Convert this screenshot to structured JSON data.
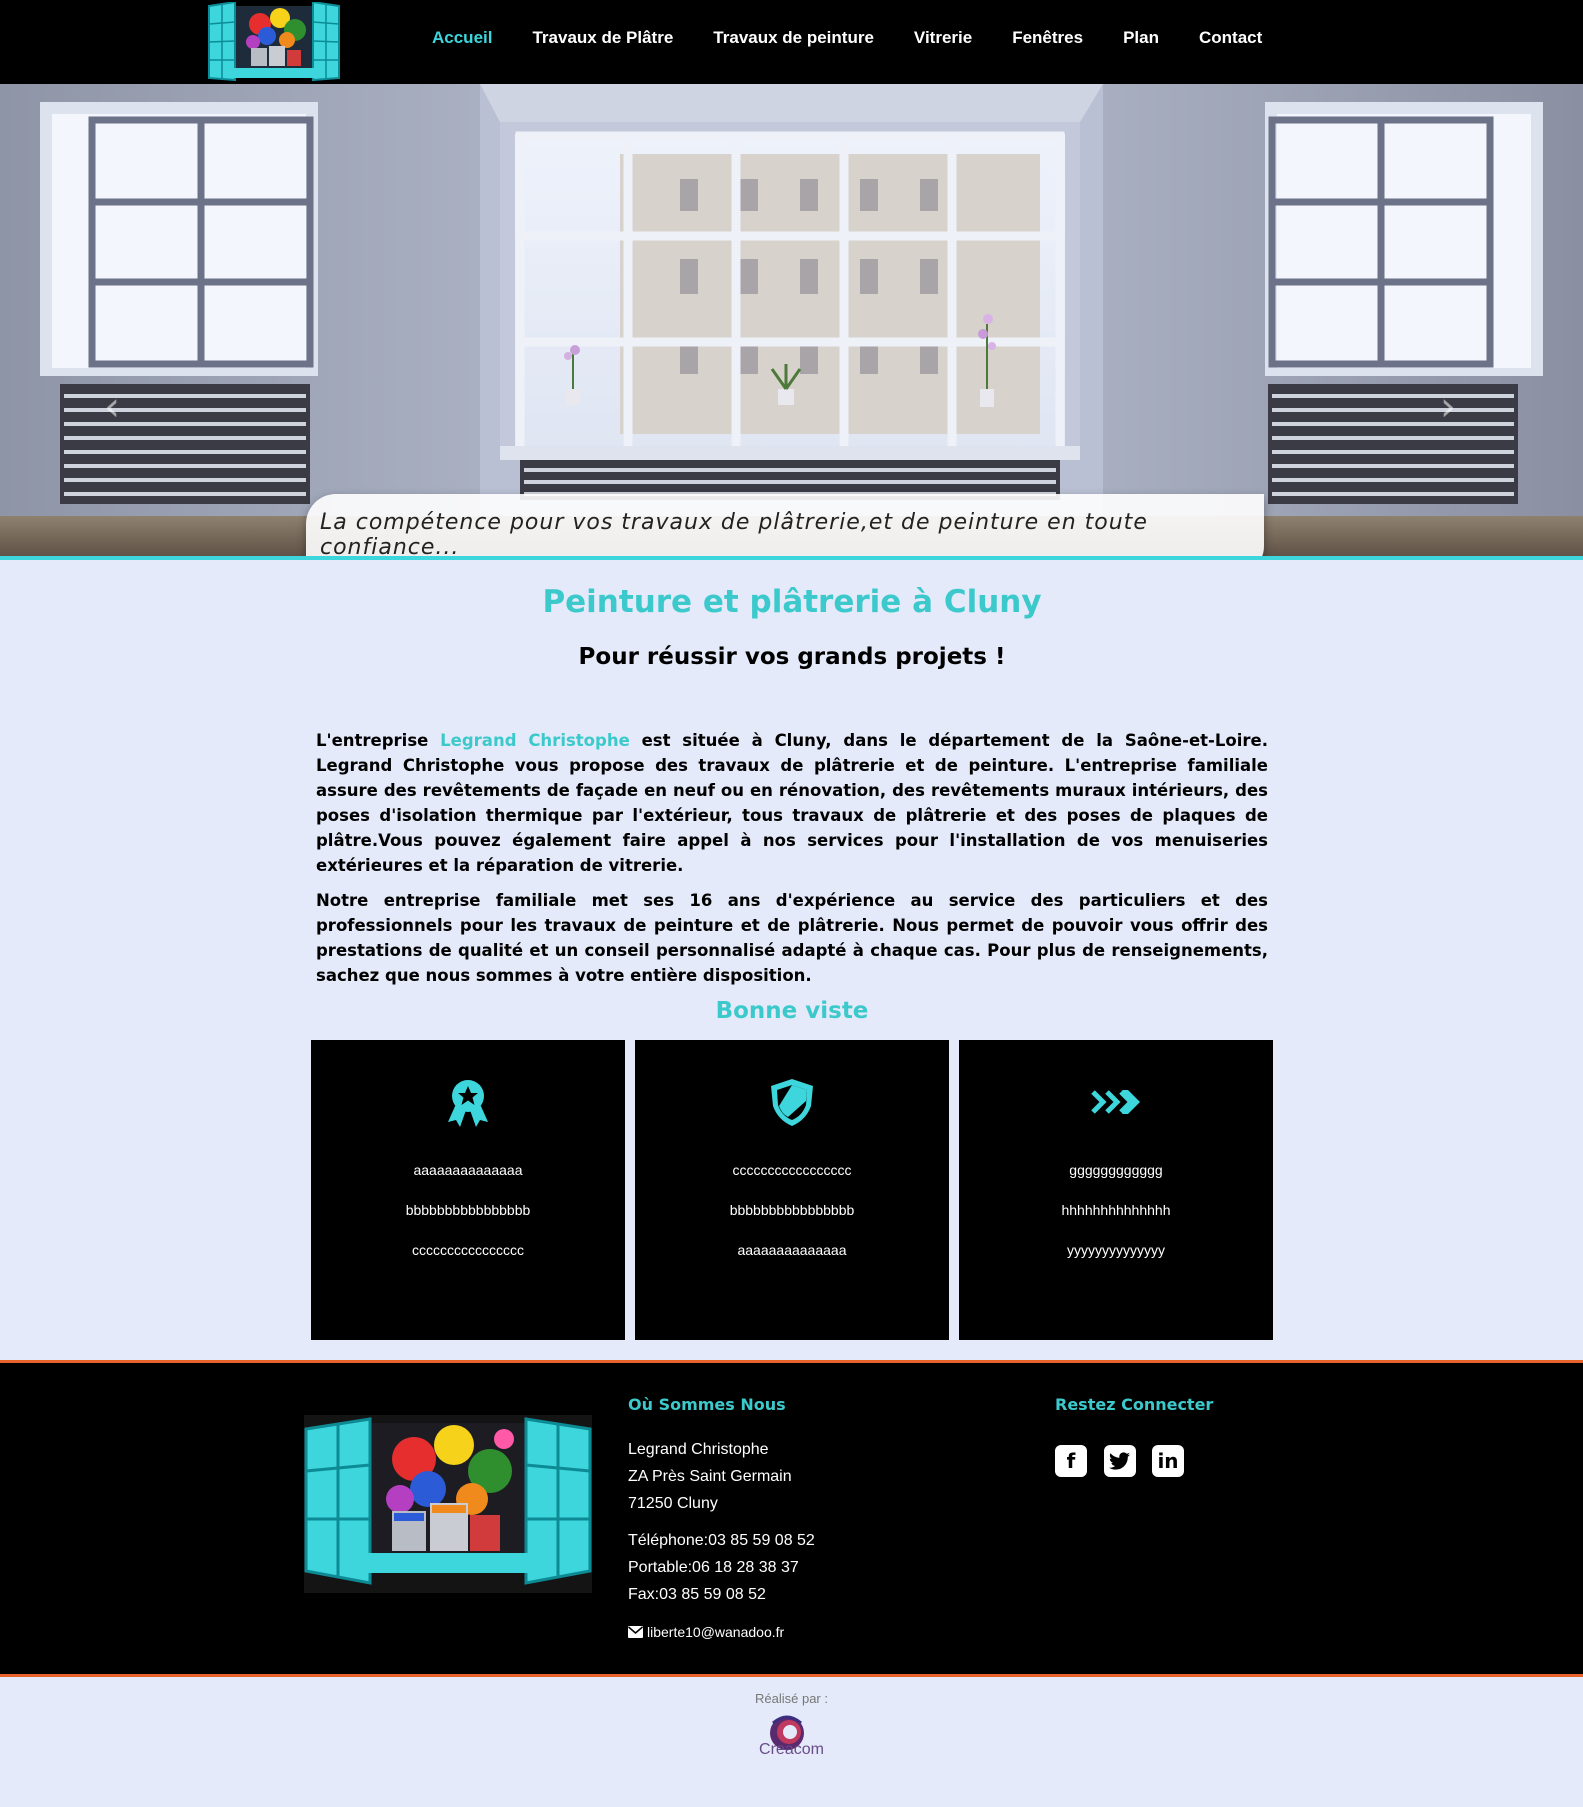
{
  "nav": {
    "items": [
      {
        "label": "Accueil",
        "active": true
      },
      {
        "label": "Travaux de Plâtre",
        "active": false
      },
      {
        "label": "Travaux de peinture",
        "active": false
      },
      {
        "label": "Vitrerie",
        "active": false
      },
      {
        "label": "Fenêtres",
        "active": false
      },
      {
        "label": "Plan",
        "active": false
      },
      {
        "label": "Contact",
        "active": false
      }
    ]
  },
  "hero": {
    "caption": "La compétence pour vos travaux  de plâtrerie,et de peinture en toute confiance...",
    "prev_icon": "chevron-left-icon",
    "next_icon": "chevron-right-icon"
  },
  "main": {
    "title": "Peinture et plâtrerie à Cluny",
    "subtitle": "Pour réussir vos grands projets !",
    "p1_before": "L'entreprise ",
    "p1_company": "Legrand Christophe",
    "p1_after": "  est située à Cluny, dans le département de la Saône-et-Loire. Legrand Christophe vous propose des travaux de plâtrerie et de peinture. L'entreprise familiale assure des revêtements de façade en neuf ou en rénovation, des revêtements muraux intérieurs, des poses d'isolation thermique par l'extérieur, tous travaux de plâtrerie et des poses de plaques de plâtre.Vous pouvez également faire appel à nos services pour l'installation de vos menuiseries extérieures et la réparation de vitrerie.",
    "p2": "Notre entreprise familiale met ses 16 ans d'expérience au service des particuliers et des professionnels pour les travaux de peinture et de plâtrerie. Nous permet de pouvoir vous offrir des prestations de qualité et un conseil personnalisé adapté à chaque cas. Pour plus de renseignements, sachez que nous sommes à votre entière disposition.",
    "section_title": "Bonne viste",
    "accent_color": "#3cc9cc"
  },
  "features": [
    {
      "icon": "award-ribbon-icon",
      "lines": [
        "aaaaaaaaaaaaaa",
        "bbbbbbbbbbbbbbbb",
        "cccccccccccccccc"
      ]
    },
    {
      "icon": "shield-icon",
      "lines": [
        "ccccccccccccccccc",
        "bbbbbbbbbbbbbbbb",
        "aaaaaaaaaaaaaa"
      ]
    },
    {
      "icon": "triple-chevron-right-icon",
      "lines": [
        "gggggggggggg",
        "hhhhhhhhhhhhhh",
        "yyyyyyyyyyyyyy"
      ]
    }
  ],
  "footer": {
    "location_heading": "Où Sommes Nous",
    "name": "Legrand Christophe",
    "address1": "ZA Près Saint Germain",
    "address2": "71250 Cluny",
    "phone": "Téléphone:03 85 59 08 52",
    "mobile": "Portable:06 18 28 38 37",
    "fax": "Fax:03 85 59 08 52",
    "email": "liberte10@wanadoo.fr",
    "social_heading": "Restez Connecter",
    "social": [
      "facebook-icon",
      "twitter-icon",
      "linkedin-icon"
    ],
    "border_color": "#e8622a"
  },
  "credit": {
    "label": "Réalisé par :",
    "brand": "Creacom"
  }
}
